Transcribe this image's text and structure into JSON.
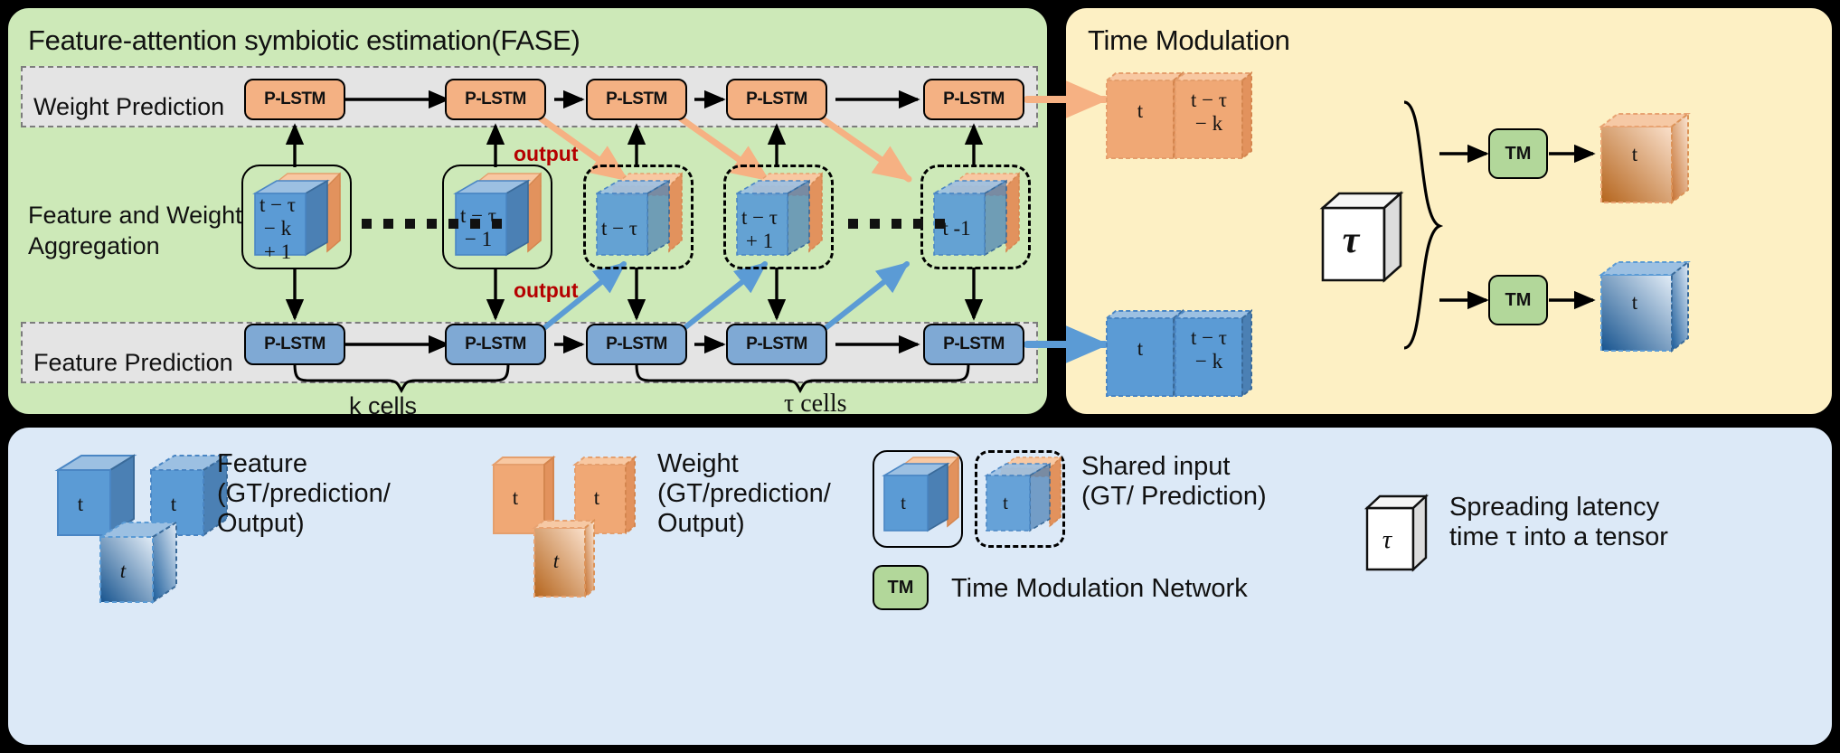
{
  "panels": {
    "fase_title": "Feature-attention symbiotic estimation(FASE)",
    "time_modulation_title": "Time Modulation"
  },
  "fase": {
    "rows": {
      "weight_prediction_label": "Weight Prediction",
      "aggregation_label": "Feature and Weight\nAggregation",
      "feature_prediction_label": "Feature Prediction"
    },
    "weight_lstms": [
      "P-LSTM",
      "P-LSTM",
      "P-LSTM",
      "P-LSTM",
      "P-LSTM"
    ],
    "feature_lstms": [
      "P-LSTM",
      "P-LSTM",
      "P-LSTM",
      "P-LSTM",
      "P-LSTM"
    ],
    "cells": [
      {
        "label": "t − τ\n− k\n+ 1",
        "style": "solid"
      },
      {
        "label": "t − τ\n− 1",
        "style": "solid"
      },
      {
        "label": "t − τ",
        "style": "dashed"
      },
      {
        "label": "t − τ\n+ 1",
        "style": "dashed"
      },
      {
        "label": "t -1",
        "style": "dashed"
      }
    ],
    "annotations": {
      "output_top": "output",
      "output_bottom": "output"
    },
    "braces": {
      "k_cells": "k cells",
      "tau_cells": "τ cells"
    }
  },
  "time_modulation": {
    "weight_tensor": {
      "left": "t",
      "right": "t − τ\n− k"
    },
    "feature_tensor": {
      "left": "t",
      "right": "t − τ\n− k"
    },
    "tau_cube": "τ",
    "tm_top_label": "TM",
    "tm_bottom_label": "TM",
    "out_weight": "t",
    "out_feature": "t"
  },
  "legend": {
    "feature": {
      "text": "Feature\n(GT/prediction/\nOutput)",
      "cube_labels": [
        "t",
        "t",
        "t"
      ]
    },
    "weight": {
      "text": "Weight\n(GT/prediction/\nOutput)",
      "cube_labels": [
        "t",
        "t",
        "t"
      ]
    },
    "shared_input": {
      "text": "Shared input\n(GT/ Prediction)",
      "cube_labels": [
        "t",
        "t"
      ]
    },
    "tm_network": {
      "badge": "TM",
      "text": "Time Modulation Network"
    },
    "spreading": {
      "cube_label": "τ",
      "text": "Spreading latency\ntime τ into a tensor"
    }
  },
  "colors": {
    "fase_bg": "#cde9b8",
    "time_bg": "#fdf0c4",
    "legend_bg": "#dce9f7",
    "strip_bg": "#e4e4e4",
    "weight_orange": "#f4b183",
    "feature_blue": "#7fa9d4",
    "tm_green": "#b2d79a",
    "output_red": "#b50000"
  }
}
